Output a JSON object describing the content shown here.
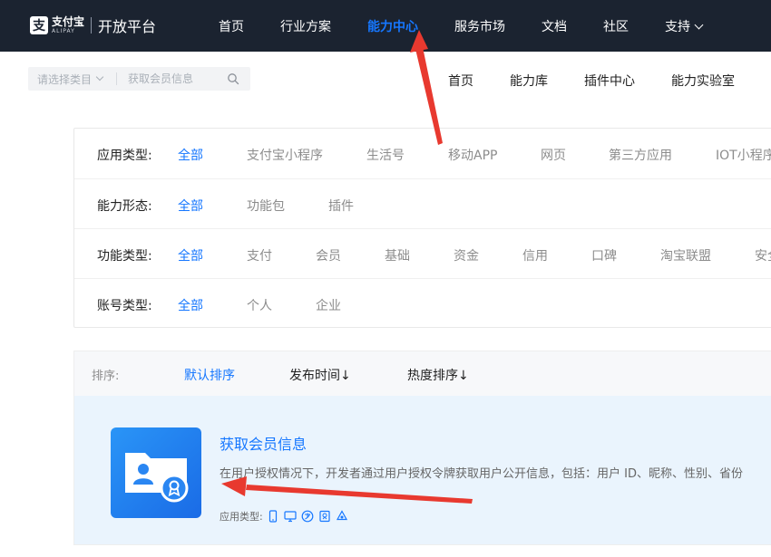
{
  "header": {
    "logo_cn": "支付宝",
    "logo_en": "ALIPAY",
    "logo_mark": "支",
    "platform_title": "开放平台",
    "nav": [
      {
        "label": "首页"
      },
      {
        "label": "行业方案"
      },
      {
        "label": "能力中心",
        "active": true
      },
      {
        "label": "服务市场"
      },
      {
        "label": "文档"
      },
      {
        "label": "社区"
      },
      {
        "label": "支持"
      }
    ]
  },
  "search": {
    "category_placeholder": "请选择类目",
    "input_placeholder": "获取会员信息"
  },
  "subnav": [
    "首页",
    "能力库",
    "插件中心",
    "能力实验室"
  ],
  "filters": [
    {
      "label": "应用类型:",
      "options": [
        "全部",
        "支付宝小程序",
        "生活号",
        "移动APP",
        "网页",
        "第三方应用",
        "IOT小程序"
      ]
    },
    {
      "label": "能力形态:",
      "options": [
        "全部",
        "功能包",
        "插件"
      ]
    },
    {
      "label": "功能类型:",
      "options": [
        "全部",
        "支付",
        "会员",
        "基础",
        "资金",
        "信用",
        "口碑",
        "淘宝联盟",
        "安全"
      ]
    },
    {
      "label": "账号类型:",
      "options": [
        "全部",
        "个人",
        "企业"
      ]
    }
  ],
  "sort": {
    "label": "排序:",
    "options": [
      "默认排序",
      "发布时间↓",
      "热度排序↓"
    ]
  },
  "result": {
    "title": "获取会员信息",
    "description": "在用户授权情况下，开发者通过用户授权令牌获取用户公开信息，包括：用户 ID、昵称、性别、省份",
    "types_label": "应用类型:",
    "type_icons": [
      "mobile-icon",
      "monitor-icon",
      "alipay-icon",
      "miniprogram-icon",
      "iot-icon"
    ]
  },
  "colors": {
    "topbar": "#1b2330",
    "accent": "#1677ff",
    "card_bg": "#eaf4fd",
    "annotation": "#e8392f"
  }
}
